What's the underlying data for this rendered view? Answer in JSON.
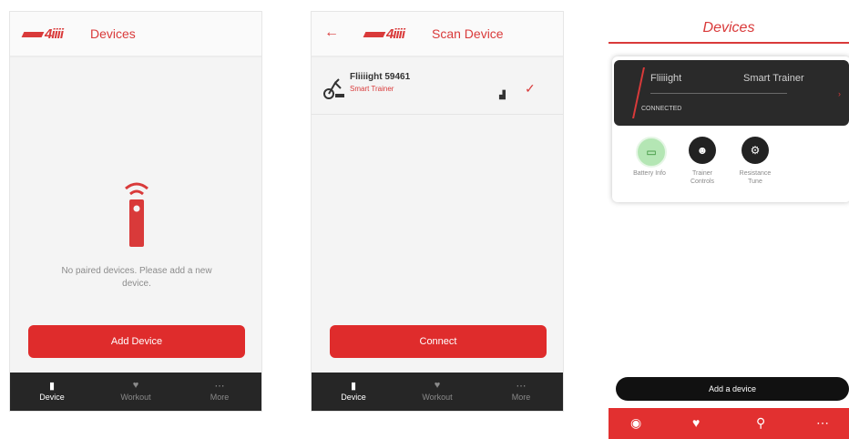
{
  "screen1": {
    "logo": "4iiii",
    "title": "Devices",
    "empty_message": "No paired devices. Please add a new device.",
    "add_button": "Add Device",
    "nav": [
      {
        "label": "Device",
        "icon": "device-icon"
      },
      {
        "label": "Workout",
        "icon": "workout-icon"
      },
      {
        "label": "More",
        "icon": "more-icon"
      }
    ]
  },
  "screen2": {
    "logo": "4iiii",
    "title": "Scan Device",
    "back_icon": "←",
    "device_name": "Fliiiight 59461",
    "device_type": "Smart Trainer",
    "connect_button": "Connect",
    "nav": [
      {
        "label": "Device",
        "icon": "device-icon"
      },
      {
        "label": "Workout",
        "icon": "workout-icon"
      },
      {
        "label": "More",
        "icon": "more-icon"
      }
    ]
  },
  "screen3": {
    "title": "Devices",
    "device_name": "Fliiiight",
    "device_type": "Smart Trainer",
    "status": "CONNECTED",
    "actions": [
      {
        "label": "Battery Info",
        "icon": "battery-icon",
        "color": "#b4e6b4"
      },
      {
        "label": "Trainer Controls",
        "icon": "trainer-icon",
        "color": "#222222"
      },
      {
        "label": "Resistance Tune",
        "icon": "resistance-icon",
        "color": "#222222"
      }
    ],
    "add_button": "Add a device",
    "nav_icons": [
      "device-icon",
      "heart-icon",
      "location-icon",
      "more-icon"
    ]
  },
  "colors": {
    "accent": "#d93a3a",
    "dark": "#262626",
    "background": "#f4f4f4"
  }
}
